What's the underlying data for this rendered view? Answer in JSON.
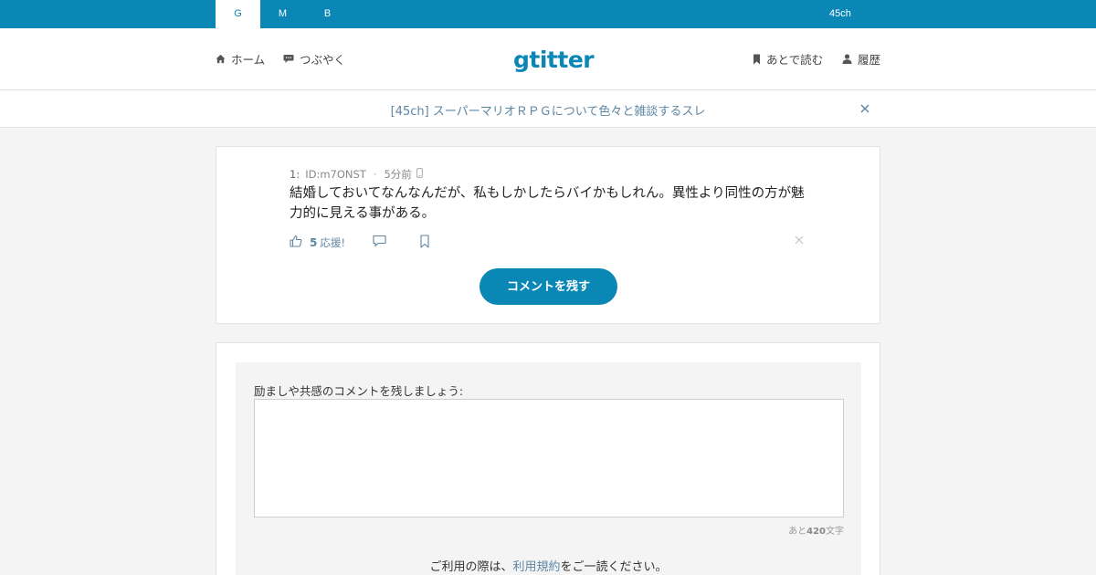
{
  "topbar": {
    "tabs": [
      {
        "label": "G",
        "active": true
      },
      {
        "label": "M",
        "active": false
      },
      {
        "label": "B",
        "active": false
      }
    ],
    "site_label": "45ch",
    "color": "#0a87b5"
  },
  "header": {
    "home_label": "ホーム",
    "tweet_label": "つぶやく",
    "logo": "gtitter",
    "read_later_label": "あとで読む",
    "history_label": "履歴",
    "icons": [
      "home-icon",
      "speech-bubble-icon",
      "bookmark-icon",
      "user-icon"
    ]
  },
  "thread": {
    "title": "[45ch] スーパーマリオＲＰＧについて色々と雑談するスレ",
    "close_icon": "close-icon"
  },
  "post": {
    "number": "1:",
    "id": "ID:m7ONST",
    "time": "5分前",
    "device_icon": "mobile-icon",
    "body": "結婚しておいてなんなんだが、私もしかしたらバイかもしれん。異性より同性の方が魅力的に見える事がある。",
    "like_count": "5",
    "like_label": "応援!",
    "comment_button": "コメントを残す"
  },
  "comment_form": {
    "label": "励ましや共感のコメントを残しましょう:",
    "textarea_value": "",
    "remaining_prefix": "あと",
    "remaining_count": "420",
    "remaining_suffix": "文字",
    "terms_prefix": "ご利用の際は、",
    "terms_link": "利用規約",
    "terms_suffix": "をご一読ください。"
  }
}
